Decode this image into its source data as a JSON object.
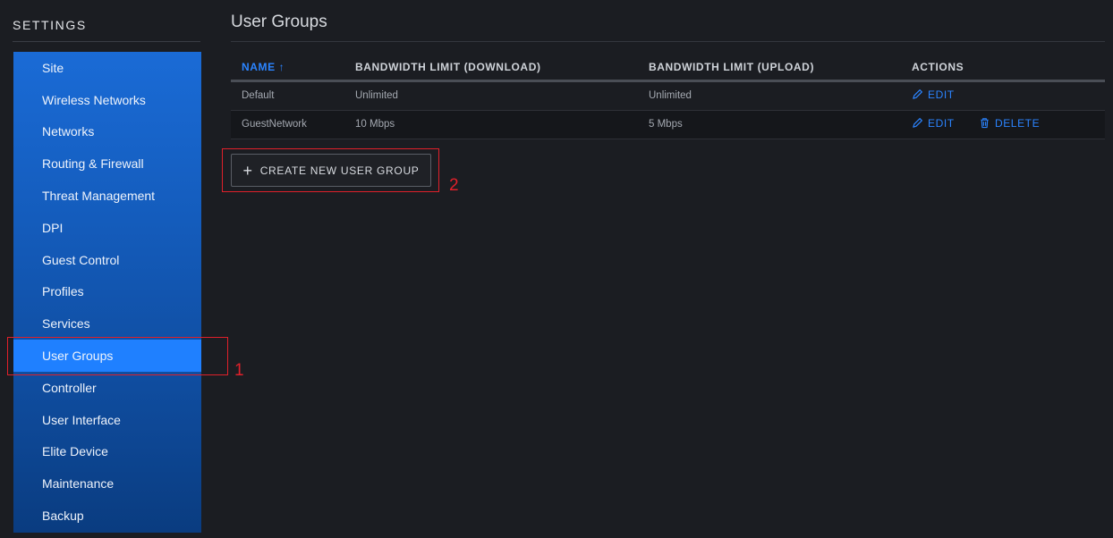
{
  "sidebar": {
    "title": "SETTINGS",
    "items": [
      {
        "label": "Site"
      },
      {
        "label": "Wireless Networks"
      },
      {
        "label": "Networks"
      },
      {
        "label": "Routing & Firewall"
      },
      {
        "label": "Threat Management"
      },
      {
        "label": "DPI"
      },
      {
        "label": "Guest Control"
      },
      {
        "label": "Profiles"
      },
      {
        "label": "Services"
      },
      {
        "label": "User Groups",
        "active": true
      },
      {
        "label": "Controller"
      },
      {
        "label": "User Interface"
      },
      {
        "label": "Elite Device"
      },
      {
        "label": "Maintenance"
      },
      {
        "label": "Backup"
      }
    ]
  },
  "main": {
    "title": "User Groups",
    "table": {
      "columns": [
        "NAME ↑",
        "BANDWIDTH LIMIT (DOWNLOAD)",
        "BANDWIDTH LIMIT (UPLOAD)",
        "ACTIONS"
      ],
      "rows": [
        {
          "name": "Default",
          "download": "Unlimited",
          "upload": "Unlimited"
        },
        {
          "name": "GuestNetwork",
          "download": "10 Mbps",
          "upload": "5 Mbps"
        }
      ],
      "edit_label": "EDIT",
      "delete_label": "DELETE"
    },
    "create_label": "CREATE NEW USER GROUP"
  },
  "annotations": {
    "one": "1",
    "two": "2"
  },
  "colors": {
    "accent": "#2b84ff",
    "nav_active": "#1f80ff",
    "annotation": "#e0202a"
  }
}
